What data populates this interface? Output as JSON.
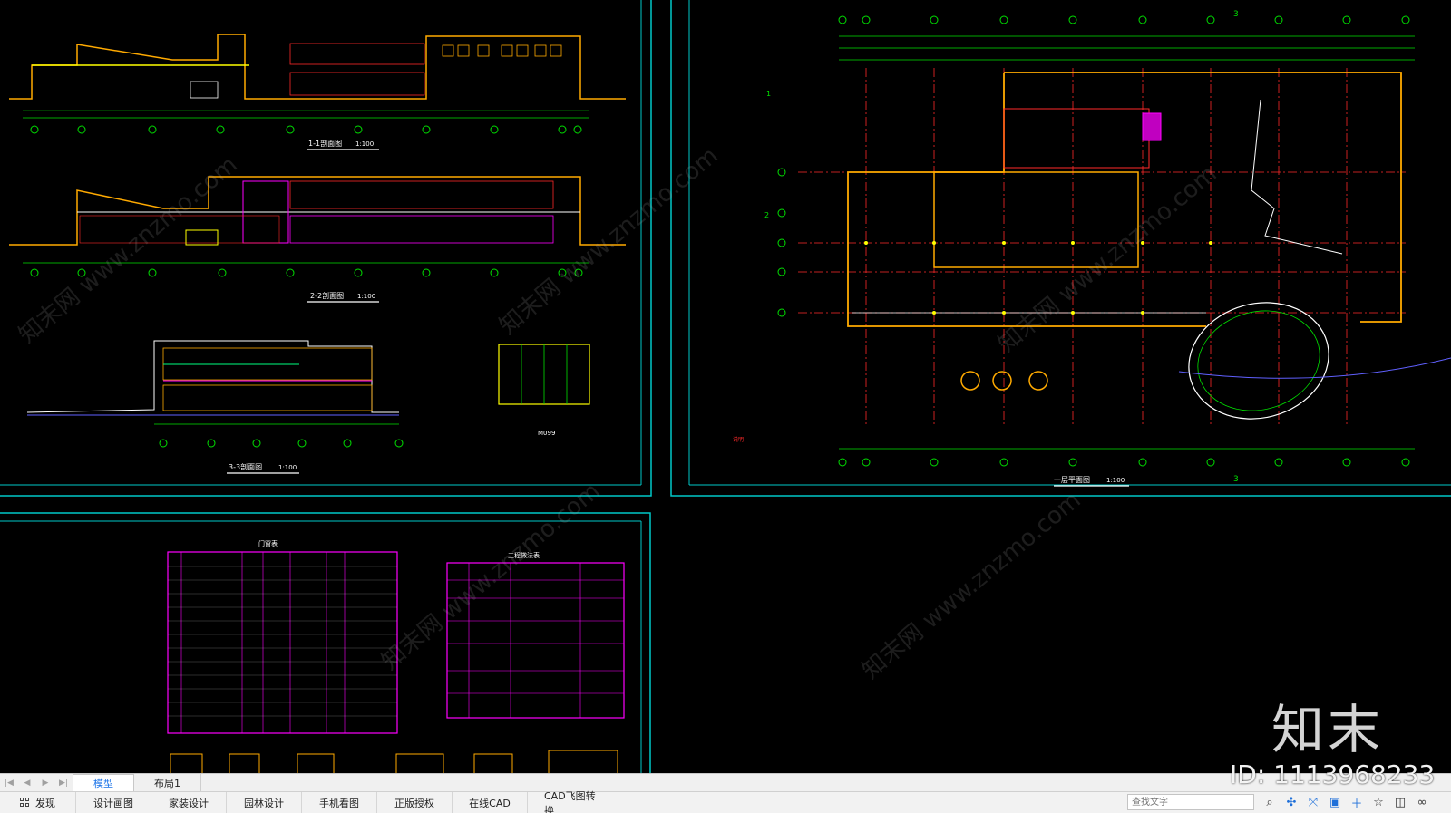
{
  "drawing": {
    "section_1_title": "1-1剖面图",
    "section_1_scale": "1:100",
    "section_2_title": "2-2剖面图",
    "section_2_scale": "1:100",
    "section_3_title": "3-3剖面图",
    "section_3_scale": "1:100",
    "door_detail_label": "M099",
    "floor_plan_title": "一层平面图",
    "floor_plan_scale": "1:100",
    "plan_marker_3_top": "3",
    "plan_marker_3_bottom": "3",
    "plan_marker_1": "1",
    "plan_marker_2": "2",
    "door_window_table_title": "门窗表",
    "construction_table_title": "工程做法表",
    "notes_label": "说明"
  },
  "layout_tabs": {
    "model_label": "模型",
    "layout1_label": "布局1"
  },
  "bottom_bar": {
    "items": [
      "发现",
      "设计画图",
      "家装设计",
      "园林设计",
      "手机看图",
      "正版授权",
      "在线CAD",
      "CAD飞图转换"
    ]
  },
  "search": {
    "placeholder": "查找文字"
  },
  "watermark": {
    "logo_text": "知末",
    "id_text": "ID: 1113968233",
    "diagonal_text": "知末网 www.znzmo.com"
  },
  "colors": {
    "background": "#000000",
    "frame": "#00c8c8",
    "wall": "#ffaa00",
    "axis": "#ff2a2a",
    "dimension": "#00e000",
    "table_border": "#ff00ff",
    "accent_tab": "#1a73e8"
  }
}
